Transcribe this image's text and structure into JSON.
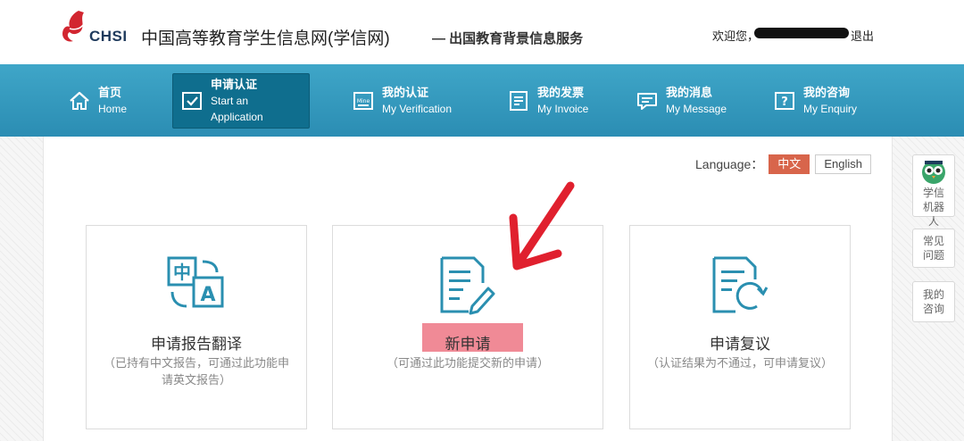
{
  "header": {
    "logo_text": "CHSI",
    "site_title": "中国高等教育学生信息网(学信网)",
    "site_sub": "— 出国教育背景信息服务",
    "welcome": "欢迎您，",
    "logout": "退出"
  },
  "nav": {
    "items": [
      {
        "zh": "首页",
        "en": "Home"
      },
      {
        "zh": "申请认证",
        "en": "Start an Application"
      },
      {
        "zh": "我的认证",
        "en": "My Verification"
      },
      {
        "zh": "我的发票",
        "en": "My Invoice"
      },
      {
        "zh": "我的消息",
        "en": "My Message"
      },
      {
        "zh": "我的咨询",
        "en": "My Enquiry"
      }
    ]
  },
  "language": {
    "label": "Language：",
    "options": [
      "中文",
      "English"
    ],
    "selected": "中文"
  },
  "cards": [
    {
      "title": "申请报告翻译",
      "desc": "（已持有中文报告，可通过此功能申请英文报告）"
    },
    {
      "title": "新申请",
      "desc": "（可通过此功能提交新的申请）"
    },
    {
      "title": "申请复议",
      "desc": "（认证结果为不通过，可申请复议）"
    }
  ],
  "sidebar_tools": [
    {
      "label": "学信机器人"
    },
    {
      "label": "常见问题"
    },
    {
      "label": "我的咨询"
    }
  ],
  "colors": {
    "nav_bg": "#2b8db3",
    "nav_active": "#0f6e8e",
    "accent_icon": "#2a8fb0",
    "lang_selected": "#d8654b",
    "highlight": "#f08a96",
    "arrow": "#e0202e"
  },
  "icons": {
    "home": "home-icon",
    "apply": "checkbox-icon",
    "verification": "mine-icon",
    "invoice": "invoice-icon",
    "message": "chat-icon",
    "enquiry": "question-icon"
  }
}
